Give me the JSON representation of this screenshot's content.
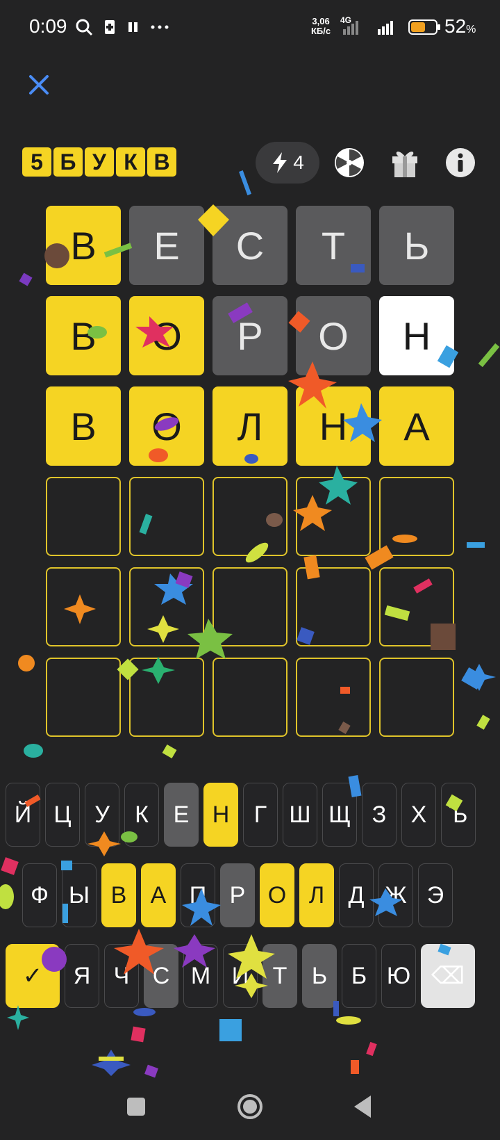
{
  "status": {
    "time": "0:09",
    "net_speed": "3,06",
    "net_unit": "КБ/с",
    "network": "4G",
    "battery": "52",
    "battery_unit": "%"
  },
  "logo": [
    "5",
    "Б",
    "У",
    "К",
    "В"
  ],
  "energy": {
    "count": "4"
  },
  "board": [
    [
      {
        "l": "В",
        "s": "yellow"
      },
      {
        "l": "Е",
        "s": "gray"
      },
      {
        "l": "С",
        "s": "gray"
      },
      {
        "l": "Т",
        "s": "gray"
      },
      {
        "l": "Ь",
        "s": "gray"
      }
    ],
    [
      {
        "l": "В",
        "s": "yellow"
      },
      {
        "l": "О",
        "s": "yellow"
      },
      {
        "l": "Р",
        "s": "gray"
      },
      {
        "l": "О",
        "s": "gray"
      },
      {
        "l": "Н",
        "s": "white"
      }
    ],
    [
      {
        "l": "В",
        "s": "yellow"
      },
      {
        "l": "О",
        "s": "yellow"
      },
      {
        "l": "Л",
        "s": "yellow"
      },
      {
        "l": "Н",
        "s": "yellow"
      },
      {
        "l": "А",
        "s": "yellow"
      }
    ],
    [
      {
        "l": "",
        "s": "empty"
      },
      {
        "l": "",
        "s": "empty"
      },
      {
        "l": "",
        "s": "empty"
      },
      {
        "l": "",
        "s": "empty"
      },
      {
        "l": "",
        "s": "empty"
      }
    ],
    [
      {
        "l": "",
        "s": "empty"
      },
      {
        "l": "",
        "s": "empty"
      },
      {
        "l": "",
        "s": "empty"
      },
      {
        "l": "",
        "s": "empty"
      },
      {
        "l": "",
        "s": "empty"
      }
    ],
    [
      {
        "l": "",
        "s": "empty"
      },
      {
        "l": "",
        "s": "empty"
      },
      {
        "l": "",
        "s": "empty"
      },
      {
        "l": "",
        "s": "empty"
      },
      {
        "l": "",
        "s": "empty"
      }
    ]
  ],
  "keyboard": {
    "row1": [
      {
        "k": "Й",
        "s": ""
      },
      {
        "k": "Ц",
        "s": ""
      },
      {
        "k": "У",
        "s": ""
      },
      {
        "k": "К",
        "s": ""
      },
      {
        "k": "Е",
        "s": "gray"
      },
      {
        "k": "Н",
        "s": "yellow"
      },
      {
        "k": "Г",
        "s": ""
      },
      {
        "k": "Ш",
        "s": ""
      },
      {
        "k": "Щ",
        "s": ""
      },
      {
        "k": "З",
        "s": ""
      },
      {
        "k": "Х",
        "s": ""
      },
      {
        "k": "Ъ",
        "s": ""
      }
    ],
    "row2": [
      {
        "k": "Ф",
        "s": ""
      },
      {
        "k": "Ы",
        "s": ""
      },
      {
        "k": "В",
        "s": "yellow"
      },
      {
        "k": "А",
        "s": "yellow"
      },
      {
        "k": "П",
        "s": ""
      },
      {
        "k": "Р",
        "s": "gray"
      },
      {
        "k": "О",
        "s": "yellow"
      },
      {
        "k": "Л",
        "s": "yellow"
      },
      {
        "k": "Д",
        "s": ""
      },
      {
        "k": "Ж",
        "s": ""
      },
      {
        "k": "Э",
        "s": ""
      }
    ],
    "row3": [
      {
        "k": "✓",
        "s": "yellow",
        "name": "submit"
      },
      {
        "k": "Я",
        "s": ""
      },
      {
        "k": "Ч",
        "s": ""
      },
      {
        "k": "С",
        "s": "gray"
      },
      {
        "k": "М",
        "s": ""
      },
      {
        "k": "И",
        "s": ""
      },
      {
        "k": "Т",
        "s": "gray"
      },
      {
        "k": "Ь",
        "s": "gray"
      },
      {
        "k": "Б",
        "s": ""
      },
      {
        "k": "Ю",
        "s": ""
      },
      {
        "k": "⌫",
        "s": "light",
        "name": "backspace"
      }
    ]
  },
  "colors": {
    "background": "#232324",
    "correct": "#f5d423",
    "absent": "#5a5a5c",
    "accent_close": "#4a8cf5"
  },
  "icons": [
    "search-icon",
    "sim-icon",
    "pause-icon",
    "more-icon",
    "signal-icon",
    "battery-icon",
    "close-icon",
    "lightning-icon",
    "wheel-icon",
    "gift-icon",
    "info-icon",
    "stop-icon",
    "home-icon",
    "back-icon"
  ]
}
